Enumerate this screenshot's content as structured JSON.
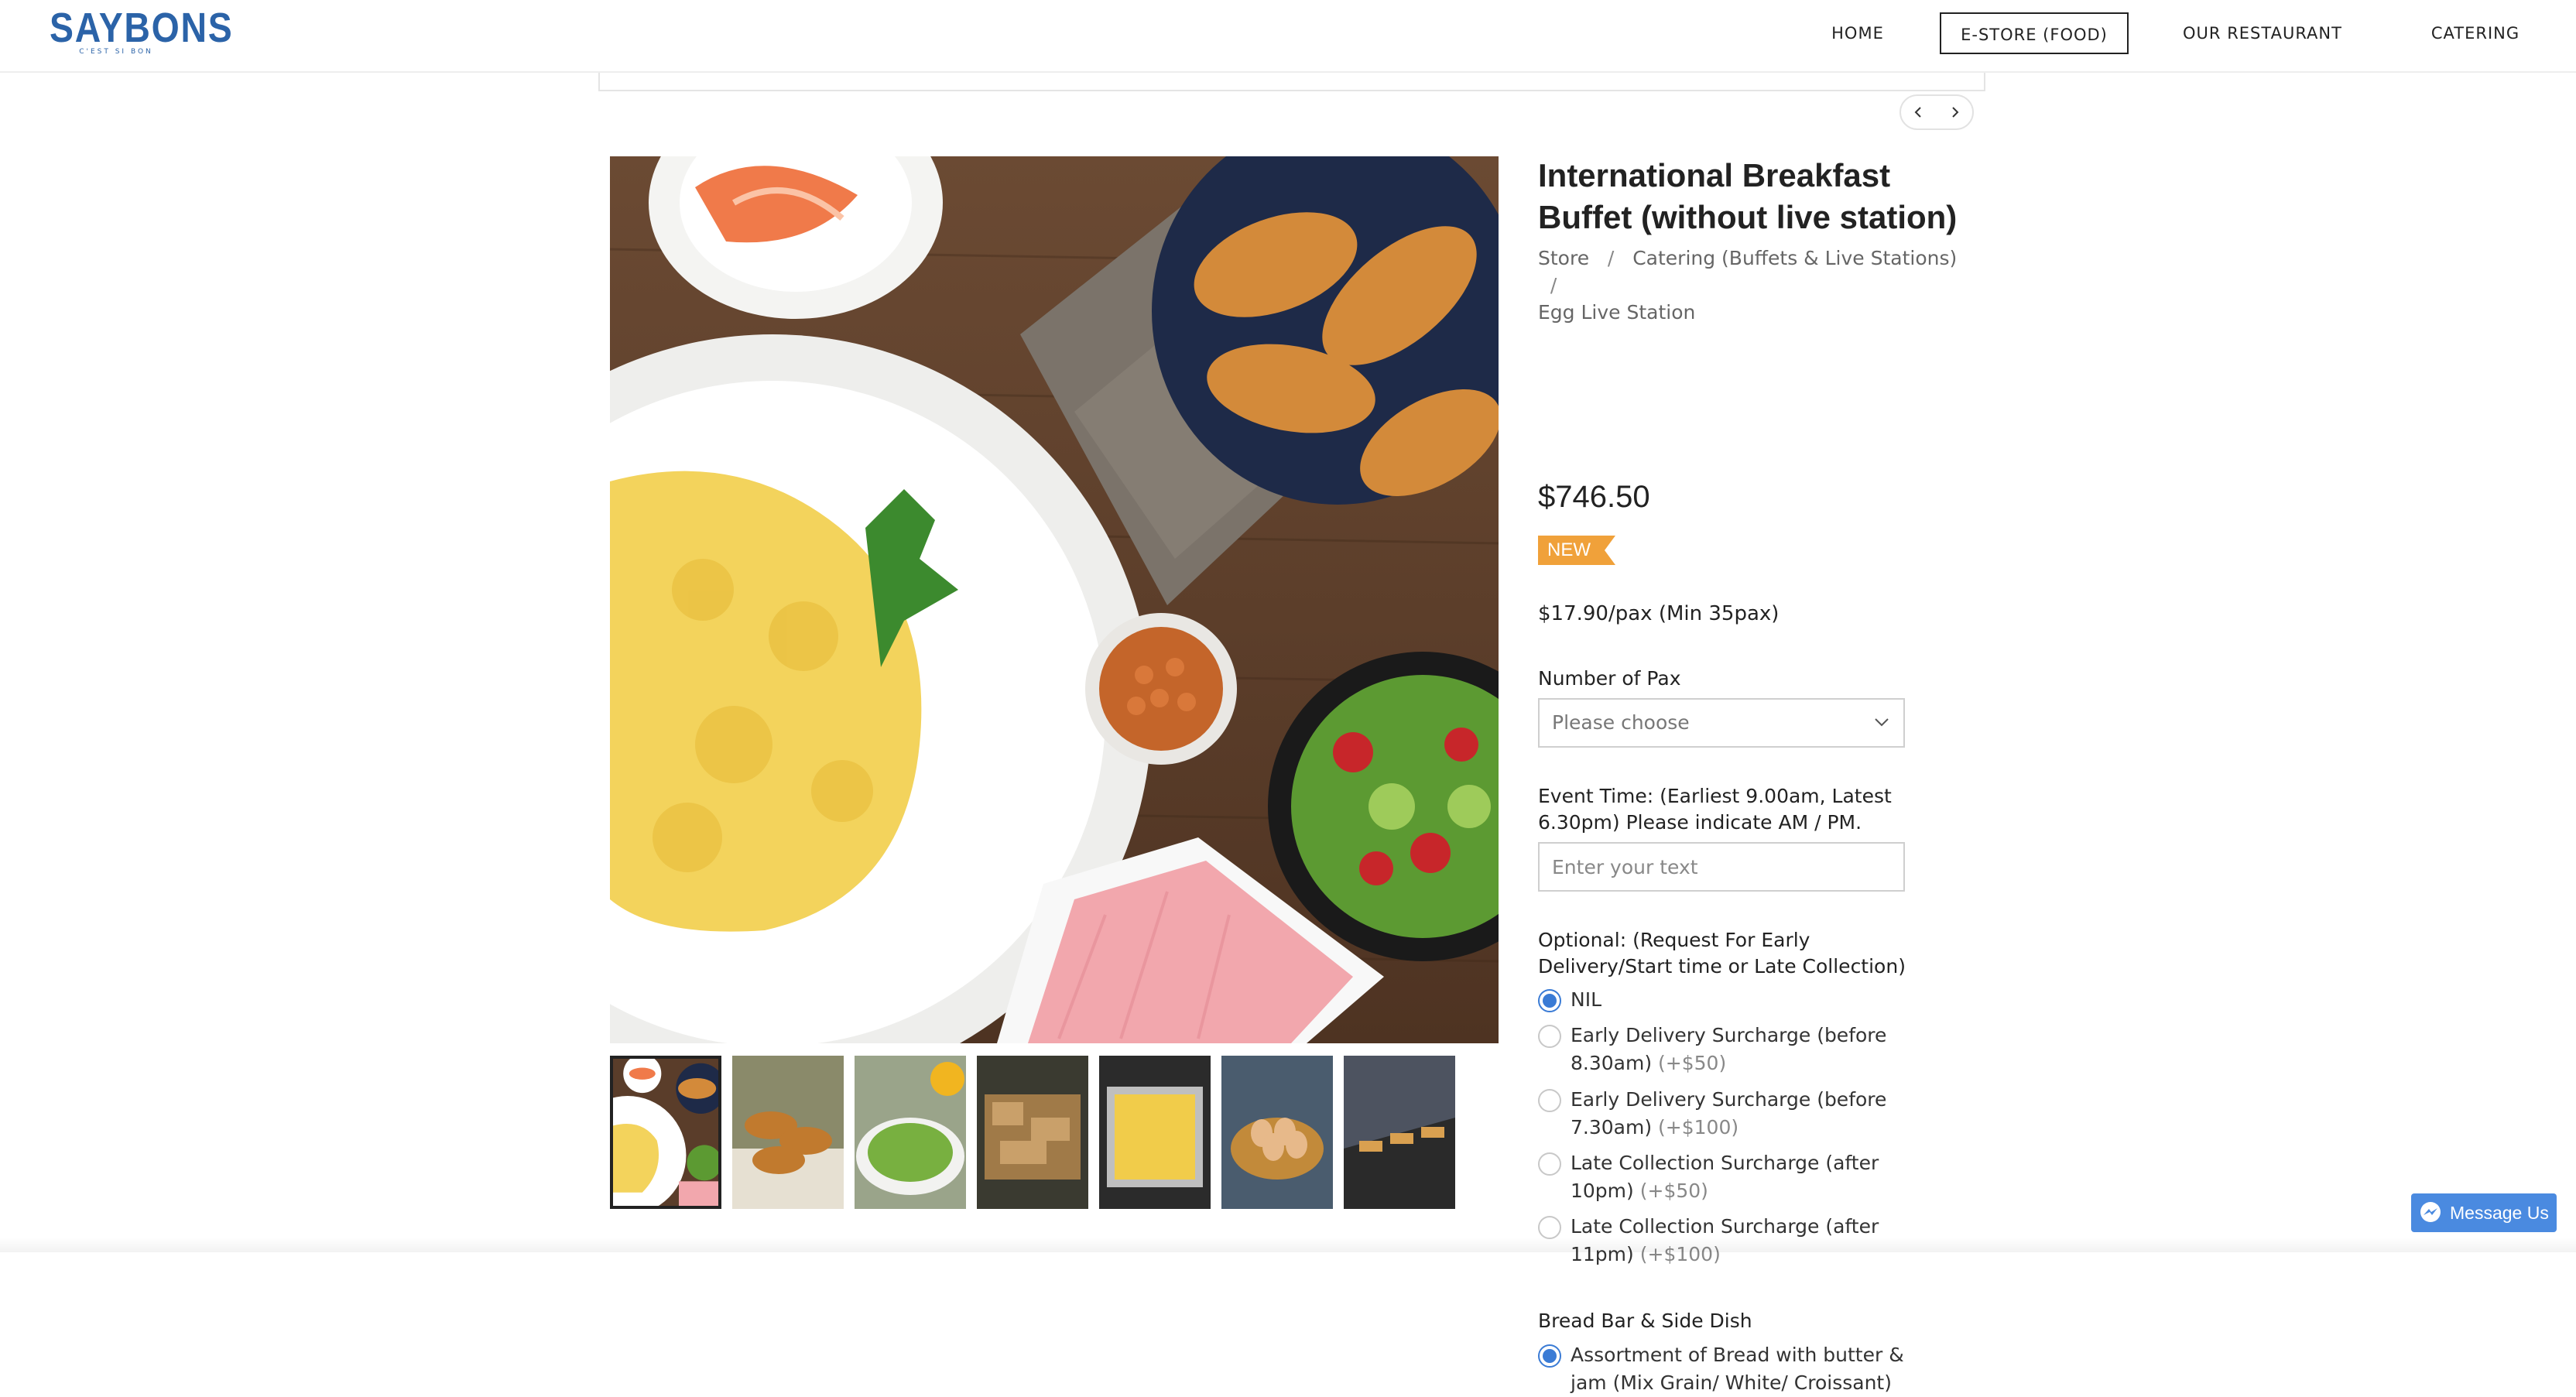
{
  "header": {
    "logo": {
      "main": "SAYBONS",
      "sub": "C'EST SI BON"
    },
    "nav": [
      {
        "label": "HOME"
      },
      {
        "label": "E-STORE (FOOD)",
        "active": true
      },
      {
        "label": "OUR RESTAURANT"
      },
      {
        "label": "CATERING"
      }
    ]
  },
  "pager": {
    "prev_icon": "chevron-left-icon",
    "next_icon": "chevron-right-icon"
  },
  "product": {
    "title": "International Breakfast Buffet (without live station)",
    "breadcrumb": [
      "Store",
      "Catering (Buffets & Live Stations)",
      "Egg Live Station"
    ],
    "breadcrumb_separator": "/",
    "price": "$746.50",
    "badge": "NEW",
    "per_pax": "$17.90/pax (Min 35pax)"
  },
  "form": {
    "pax": {
      "label": "Number of Pax",
      "placeholder": "Please choose"
    },
    "event_time": {
      "label": "Event Time: (Earliest 9.00am, Latest 6.30pm) Please indicate AM / PM.",
      "placeholder": "Enter your text"
    },
    "optional": {
      "label": "Optional: (Request For Early Delivery/Start time or Late Collection)",
      "options": [
        {
          "text": "NIL",
          "surcharge": "",
          "checked": true
        },
        {
          "text": "Early Delivery Surcharge (before 8.30am)",
          "surcharge": "(+$50)",
          "checked": false
        },
        {
          "text": "Early Delivery Surcharge (before 7.30am)",
          "surcharge": "(+$100)",
          "checked": false
        },
        {
          "text": "Late Collection Surcharge (after 10pm)",
          "surcharge": "(+$50)",
          "checked": false
        },
        {
          "text": "Late Collection Surcharge (after 11pm)",
          "surcharge": "(+$100)",
          "checked": false
        }
      ]
    },
    "bread_bar": {
      "label": "Bread Bar & Side Dish",
      "options": [
        {
          "text": "Assortment of Bread with butter & jam (Mix Grain/ White/ Croissant)",
          "checked": true
        }
      ]
    }
  },
  "gallery": {
    "thumbnails": [
      "breakfast-spread",
      "croissants",
      "salad",
      "bread-basket",
      "scrambled-egg-tray",
      "eggs-bowl",
      "buffet-table"
    ],
    "selected_index": 0
  },
  "messenger": {
    "label": "Message Us",
    "icon": "messenger-icon"
  },
  "colors": {
    "brand": "#2b63a8",
    "badge": "#f0a13a",
    "radio": "#3a7bd5",
    "messenger": "#4a8ae0"
  }
}
